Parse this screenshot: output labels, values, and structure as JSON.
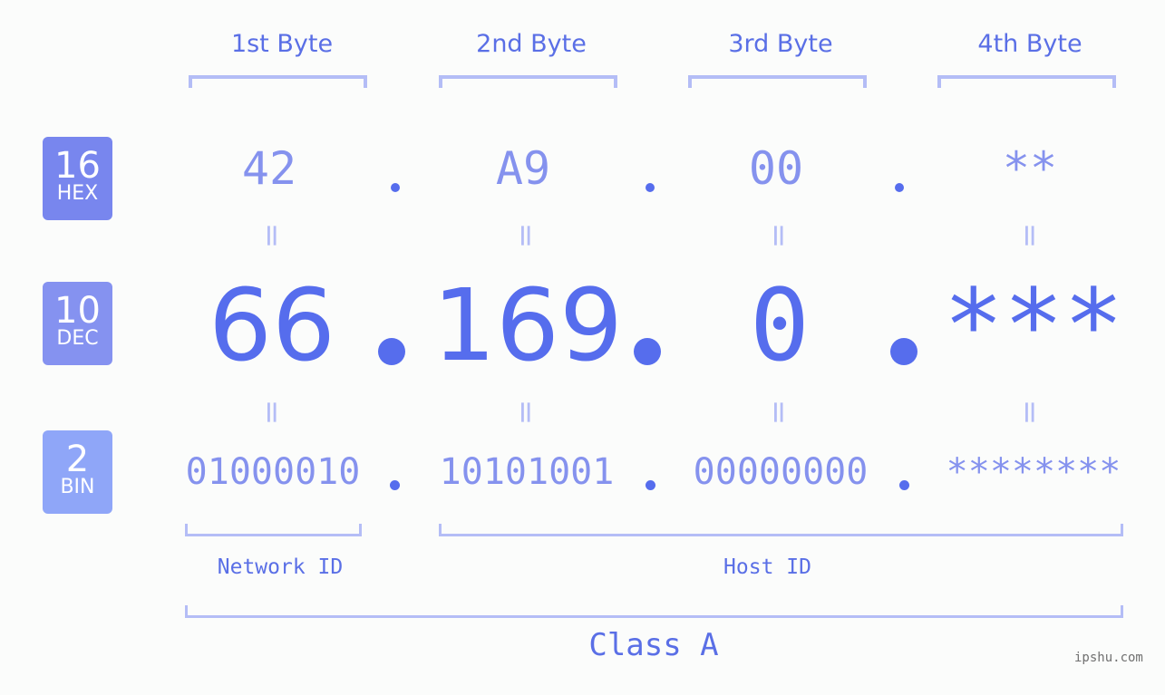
{
  "byte_headers": [
    "1st Byte",
    "2nd Byte",
    "3rd Byte",
    "4th Byte"
  ],
  "badges": [
    {
      "number": "16",
      "label": "HEX",
      "color": "#7886ee"
    },
    {
      "number": "10",
      "label": "DEC",
      "color": "#8592f0"
    },
    {
      "number": "2",
      "label": "BIN",
      "color": "#8fa6f8"
    }
  ],
  "hex_values": [
    "42",
    "A9",
    "00",
    "**"
  ],
  "dec_values": [
    "66",
    "169",
    "0",
    "***"
  ],
  "bin_values": [
    "01000010",
    "10101001",
    "00000000",
    "********"
  ],
  "equals_symbol": "=",
  "network_id_label": "Network ID",
  "host_id_label": "Host ID",
  "class_label": "Class A",
  "watermark": "ipshu.com",
  "colors": {
    "accent": "#566ded",
    "light_accent": "#8592ee",
    "bracket": "#b4bdf6",
    "background": "#fbfcfb"
  }
}
